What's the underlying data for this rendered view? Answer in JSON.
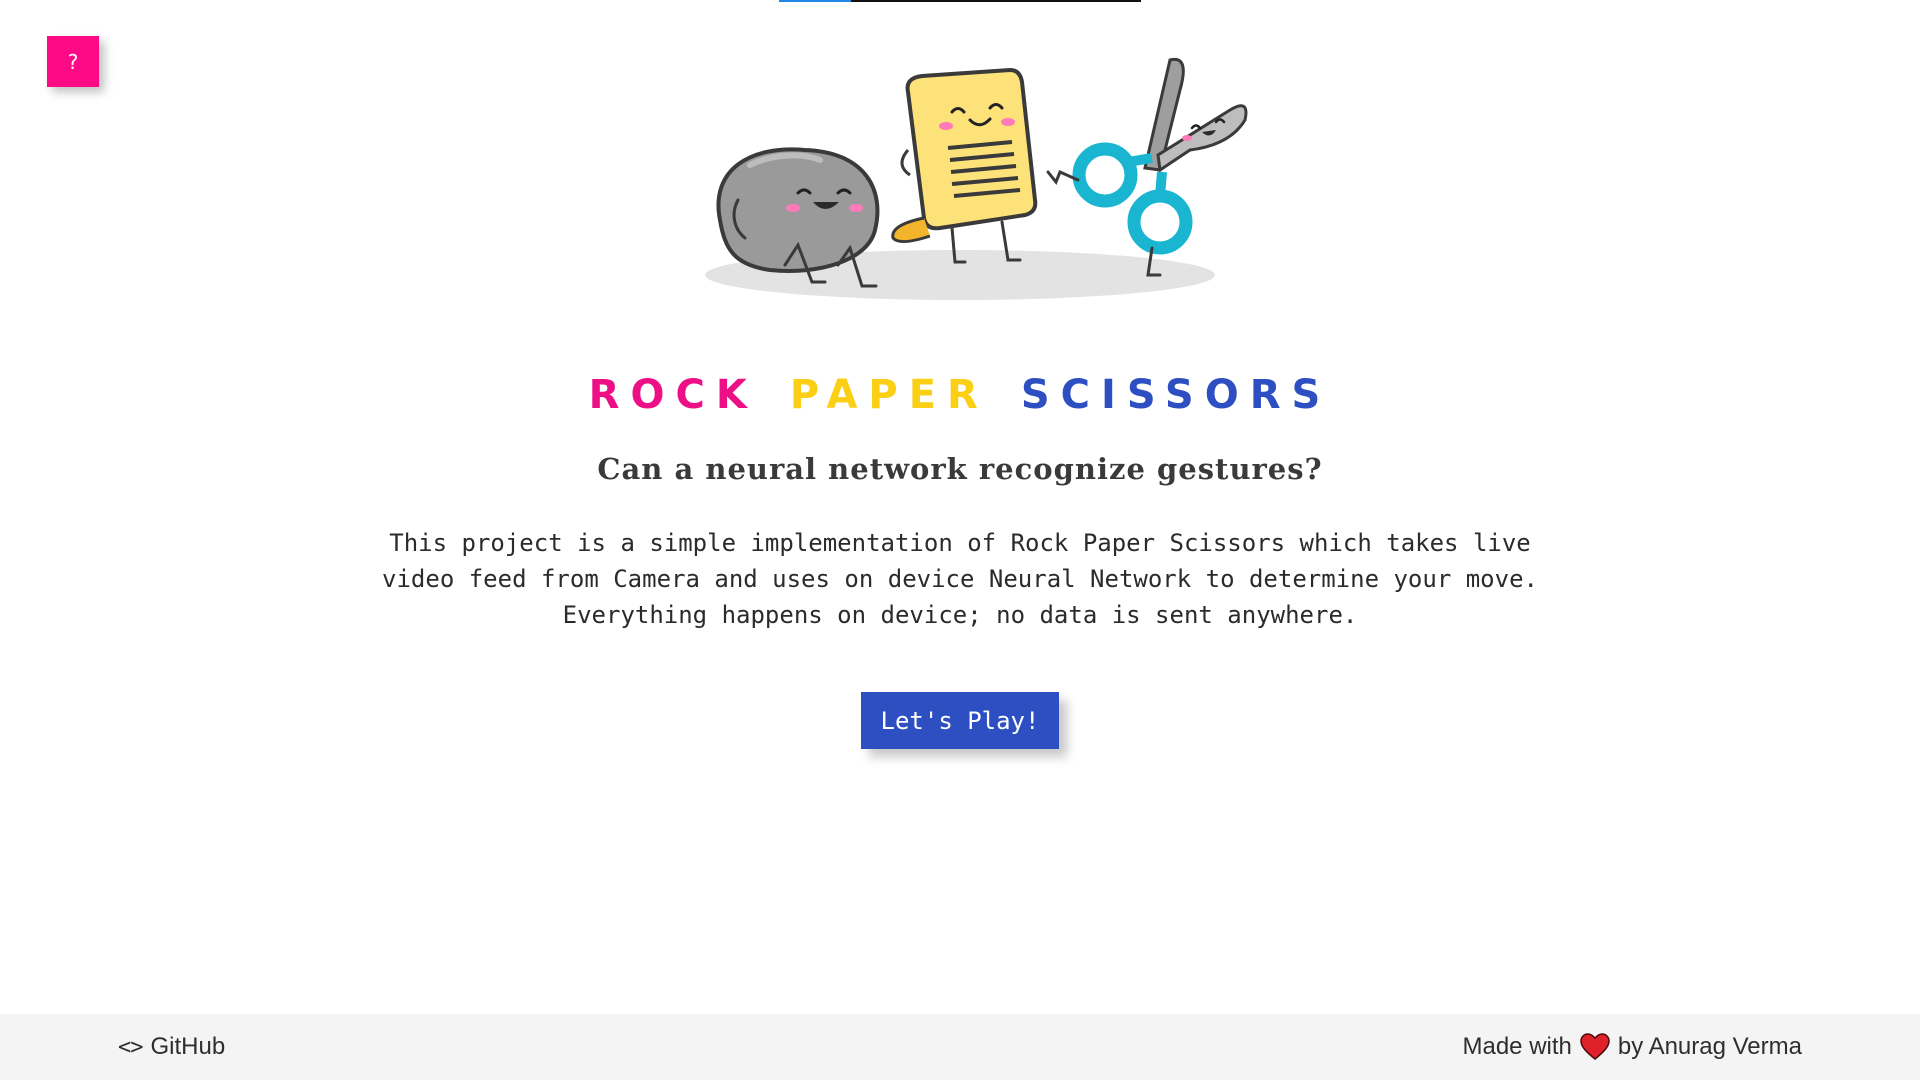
{
  "loading_bar": {
    "progress": 0.2,
    "fill_color": "#1e88e5"
  },
  "help_button": {
    "label": "?",
    "color": "#ff0a86"
  },
  "hero": {
    "illustration": "rock-paper-scissors-characters"
  },
  "title": {
    "words": [
      {
        "text": "ROCK",
        "color": "#ec0f85"
      },
      {
        "text": "PAPER",
        "color": "#fbcf14"
      },
      {
        "text": "SCISSORS",
        "color": "#2d4fc2"
      }
    ]
  },
  "subtitle": "Can a neural network recognize gestures?",
  "description": {
    "line1": "This project is a simple implementation of Rock Paper Scissors which takes live",
    "line2": "video feed from Camera and uses on device Neural Network to determine your move.",
    "line3": "Everything happens on device; no data is sent anywhere."
  },
  "play_button": {
    "label": "Let's Play!",
    "color": "#2d4fc2"
  },
  "footer": {
    "github": {
      "icon": "code-icon",
      "glyph": "<>",
      "label": "GitHub"
    },
    "credit": {
      "prefix": "Made with",
      "icon": "heart-icon",
      "suffix": "by Anurag Verma"
    }
  }
}
